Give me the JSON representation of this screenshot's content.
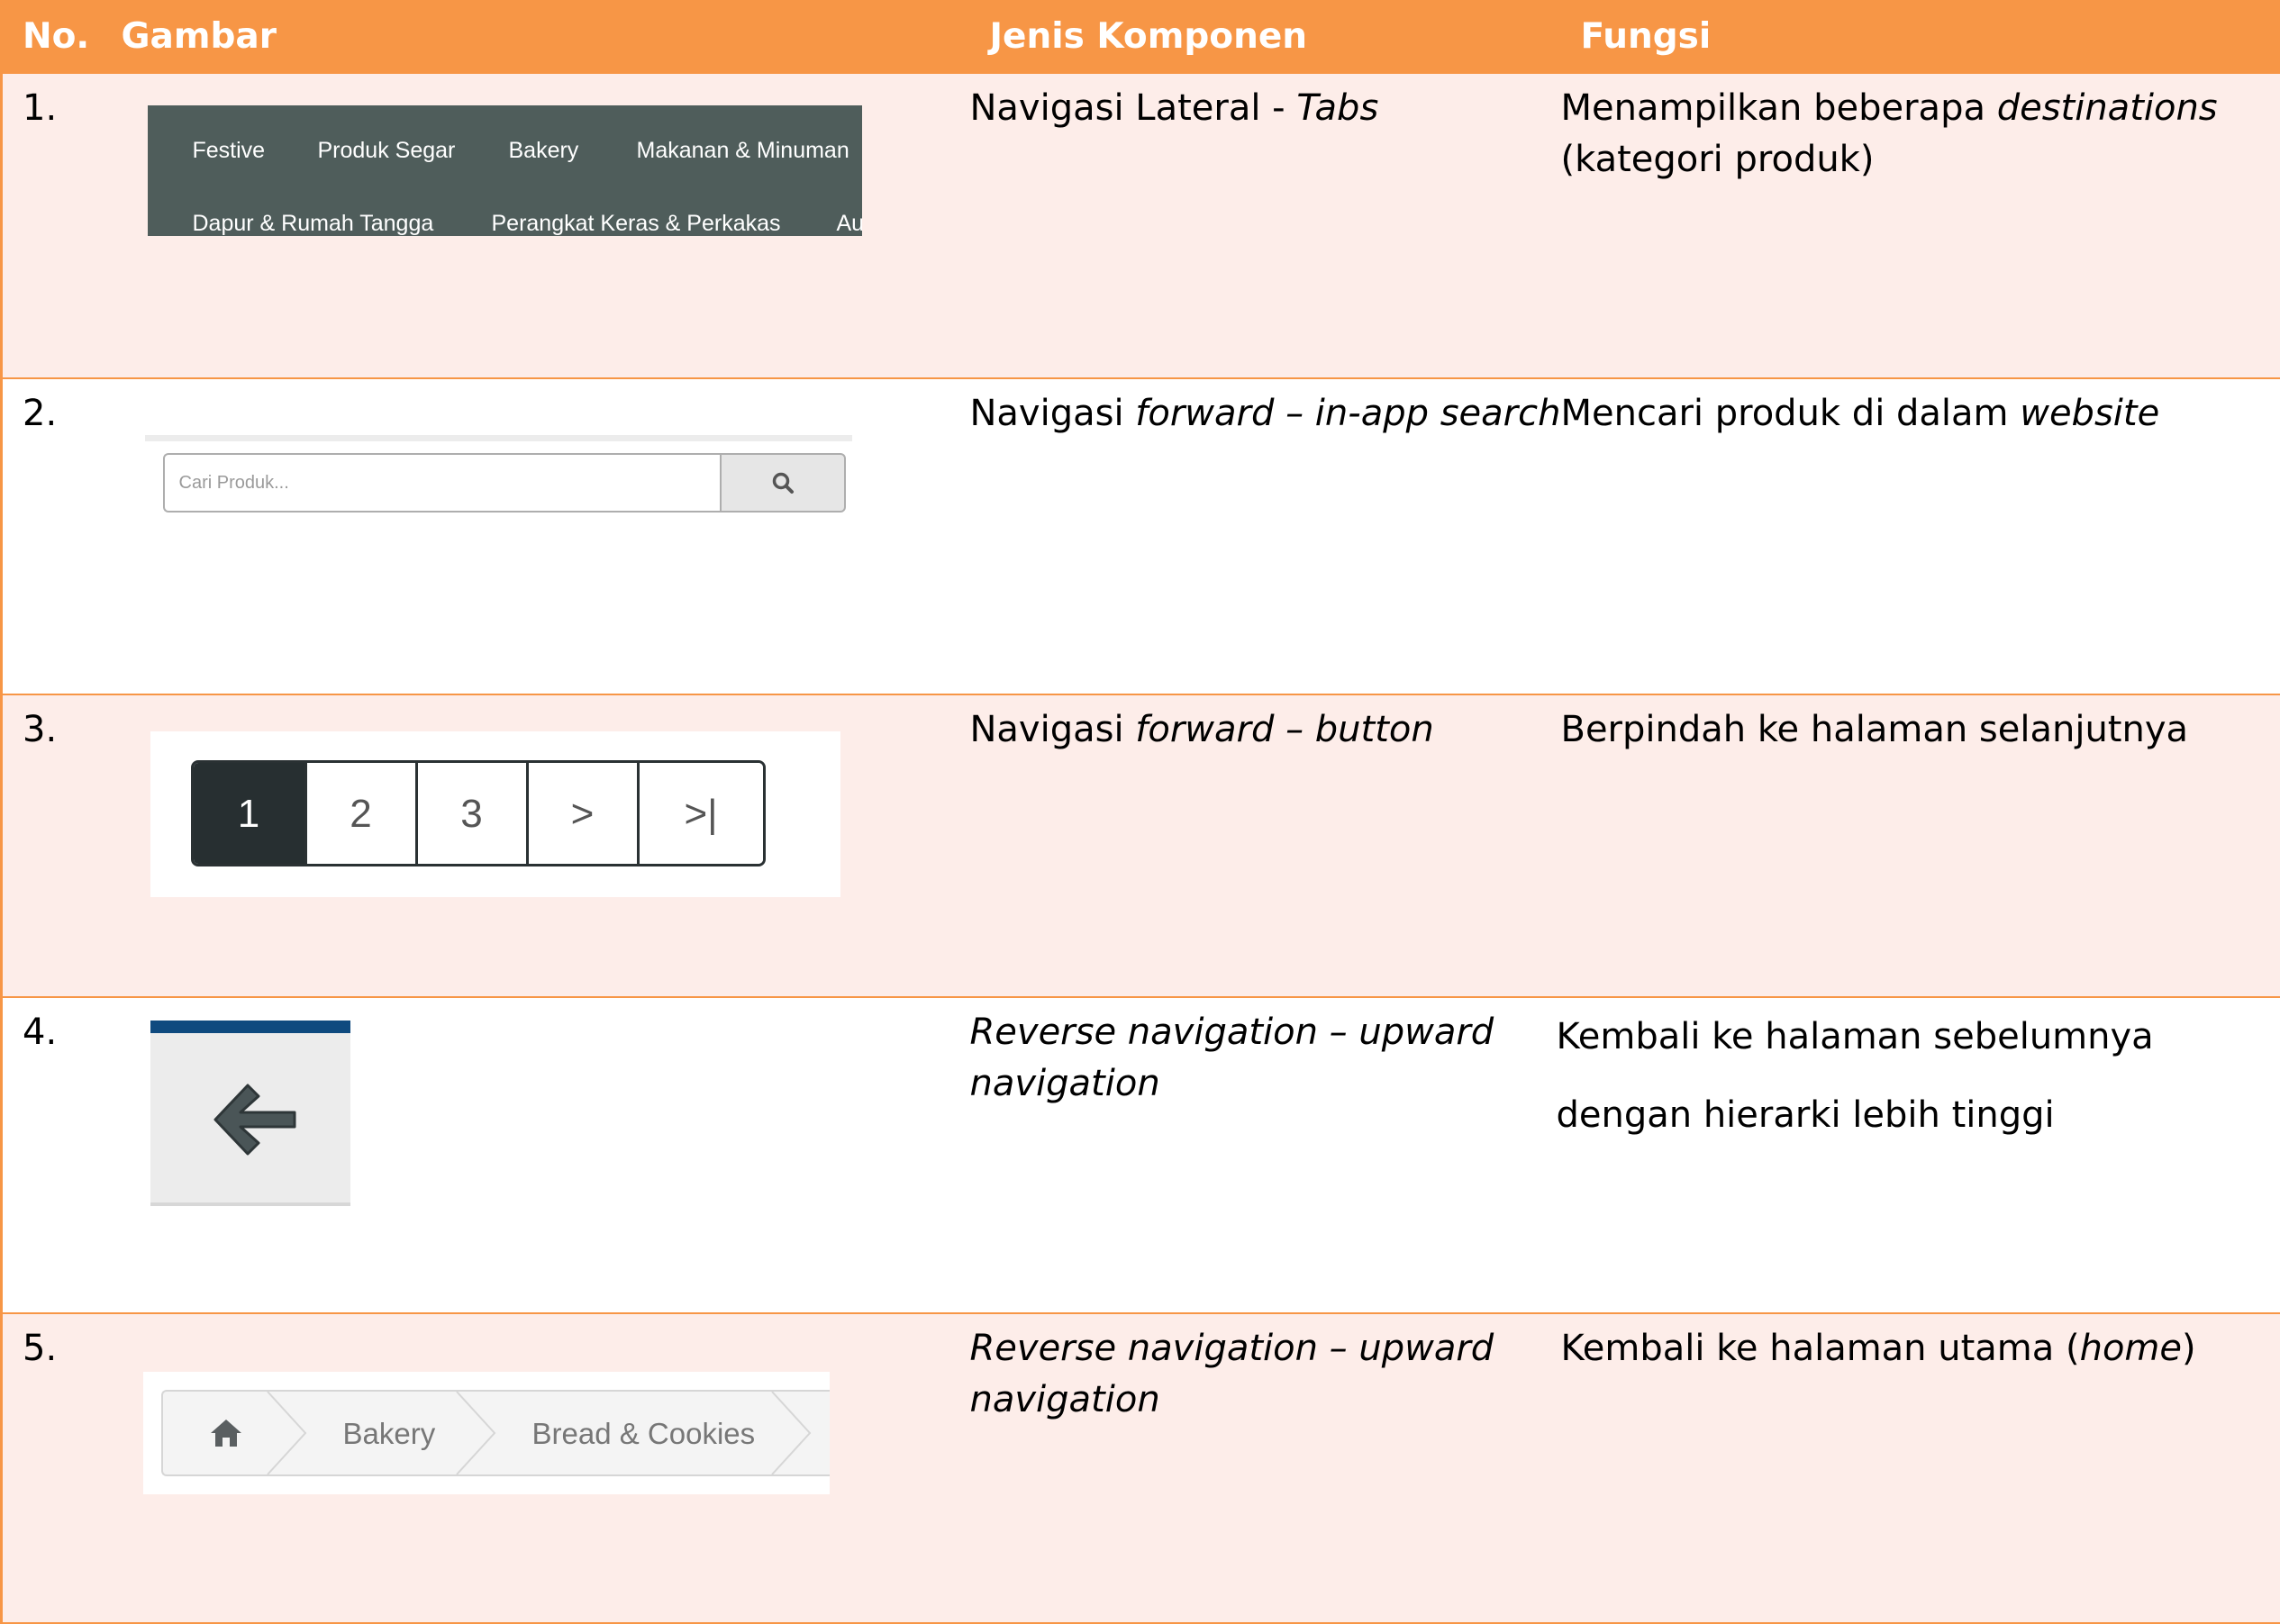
{
  "header": {
    "no": "No.",
    "image": "Gambar",
    "component_type": "Jenis Komponen",
    "function": "Fungsi"
  },
  "colors": {
    "header_bg": "#F79646",
    "odd_row_bg": "#FDEDE9",
    "even_row_bg": "#FFFFFF",
    "border": "#F79646"
  },
  "rows": [
    {
      "no": "1.",
      "type": [
        "Navigasi Lateral - ",
        "Tabs"
      ],
      "func": [
        "Menampilkan beberapa ",
        "destinations",
        " (kategori produk)"
      ],
      "image": {
        "tabs_row1": [
          "Festive",
          "Produk Segar",
          "Bakery",
          "Makanan & Minuman"
        ],
        "tabs_row2": [
          "Dapur & Rumah Tangga",
          "Perangkat Keras & Perkakas",
          "Au"
        ]
      }
    },
    {
      "no": "2.",
      "type": [
        "Navigasi ",
        "forward – in-app search"
      ],
      "func": [
        "Mencari produk di dalam ",
        "website"
      ],
      "image": {
        "placeholder": "Cari Produk...",
        "icon": "search-icon"
      }
    },
    {
      "no": "3.",
      "type": [
        "Navigasi ",
        "forward – button"
      ],
      "func": [
        "Berpindah ke halaman selanjutnya"
      ],
      "image": {
        "pages": [
          "1",
          "2",
          "3",
          ">",
          ">|"
        ]
      }
    },
    {
      "no": "4.",
      "type": [
        "Reverse navigation – upward navigation"
      ],
      "func": [
        "Kembali ke halaman sebelumnya",
        "dengan hierarki lebih tinggi"
      ],
      "image": {
        "icon": "arrow-left-icon"
      }
    },
    {
      "no": "5.",
      "type": [
        "Reverse navigation – upward navigation"
      ],
      "func": [
        "Kembali ke halaman utama (",
        "home",
        ")"
      ],
      "image": {
        "icon": "home-icon",
        "crumbs": [
          "Bakery",
          "Bread & Cookies"
        ]
      }
    }
  ]
}
